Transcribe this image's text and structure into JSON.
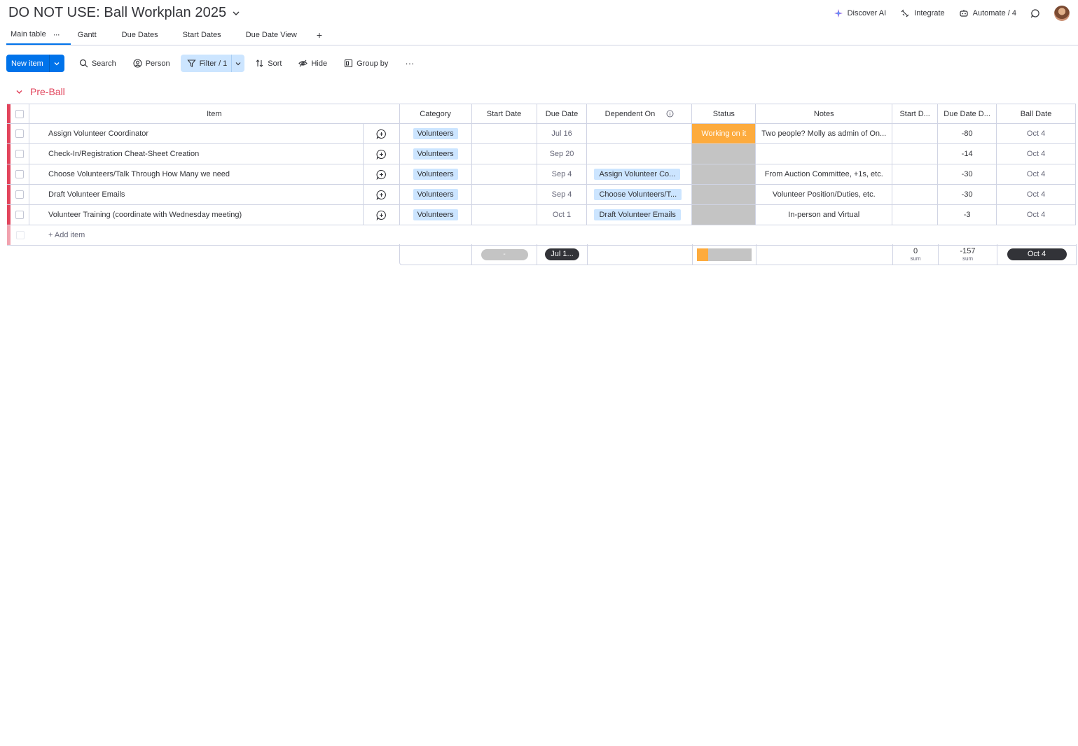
{
  "board": {
    "title": "DO NOT USE: Ball Workplan 2025"
  },
  "top_actions": [
    {
      "name": "discover-ai",
      "label": "Discover AI"
    },
    {
      "name": "integrate",
      "label": "Integrate"
    },
    {
      "name": "automate",
      "label": "Automate / 4"
    }
  ],
  "tabs": [
    {
      "label": "Main table",
      "active": true
    },
    {
      "label": "Gantt"
    },
    {
      "label": "Due Dates"
    },
    {
      "label": "Start Dates"
    },
    {
      "label": "Due Date View"
    }
  ],
  "tab_add": "+",
  "toolbar": {
    "new_item": "New item",
    "search": "Search",
    "person": "Person",
    "filter": "Filter / 1",
    "sort": "Sort",
    "hide": "Hide",
    "group_by": "Group by",
    "more": "···"
  },
  "group": {
    "name": "Pre-Ball",
    "color": "#e2445c"
  },
  "columns": {
    "item": "Item",
    "category": "Category",
    "start_date": "Start Date",
    "due_date": "Due Date",
    "dependent_on": "Dependent On",
    "status": "Status",
    "notes": "Notes",
    "start_d": "Start D...",
    "due_date_d": "Due Date D...",
    "ball_date": "Ball Date"
  },
  "rows": [
    {
      "item": "Assign Volunteer Coordinator",
      "category": "Volunteers",
      "start": "",
      "due": "Jul 16",
      "dependent": "",
      "status": "Working on it",
      "notes": "Two people? Molly as admin of On...",
      "start_d": "",
      "due_d": "-80",
      "ball": "Oct 4"
    },
    {
      "item": "Check-In/Registration Cheat-Sheet Creation",
      "category": "Volunteers",
      "start": "",
      "due": "Sep 20",
      "dependent": "",
      "status": "",
      "notes": "",
      "start_d": "",
      "due_d": "-14",
      "ball": "Oct 4"
    },
    {
      "item": "Choose Volunteers/Talk Through How Many we need",
      "category": "Volunteers",
      "start": "",
      "due": "Sep 4",
      "dependent": "Assign Volunteer Co...",
      "status": "",
      "notes": "From Auction Committee, +1s, etc.",
      "start_d": "",
      "due_d": "-30",
      "ball": "Oct 4"
    },
    {
      "item": "Draft Volunteer Emails",
      "category": "Volunteers",
      "start": "",
      "due": "Sep 4",
      "dependent": "Choose Volunteers/T...",
      "status": "",
      "notes": "Volunteer Position/Duties, etc.",
      "start_d": "",
      "due_d": "-30",
      "ball": "Oct 4"
    },
    {
      "item": "Volunteer Training (coordinate with Wednesday meeting)",
      "category": "Volunteers",
      "start": "",
      "due": "Oct 1",
      "dependent": "Draft Volunteer Emails",
      "status": "",
      "notes": "In-person and Virtual",
      "start_d": "",
      "due_d": "-3",
      "ball": "Oct 4"
    }
  ],
  "add_item": "+ Add item",
  "summary": {
    "start_range": "-",
    "due_range": "Jul 1...",
    "status_working_fraction": 0.2,
    "start_d_sum": "0",
    "start_d_label": "sum",
    "due_d_sum": "-157",
    "due_d_label": "sum",
    "ball_range": "Oct 4"
  },
  "colors": {
    "accent": "#0073ea",
    "working_on_it": "#fdab3d",
    "empty_status": "#c4c4c4",
    "chip": "#cce5ff",
    "group": "#e2445c"
  }
}
